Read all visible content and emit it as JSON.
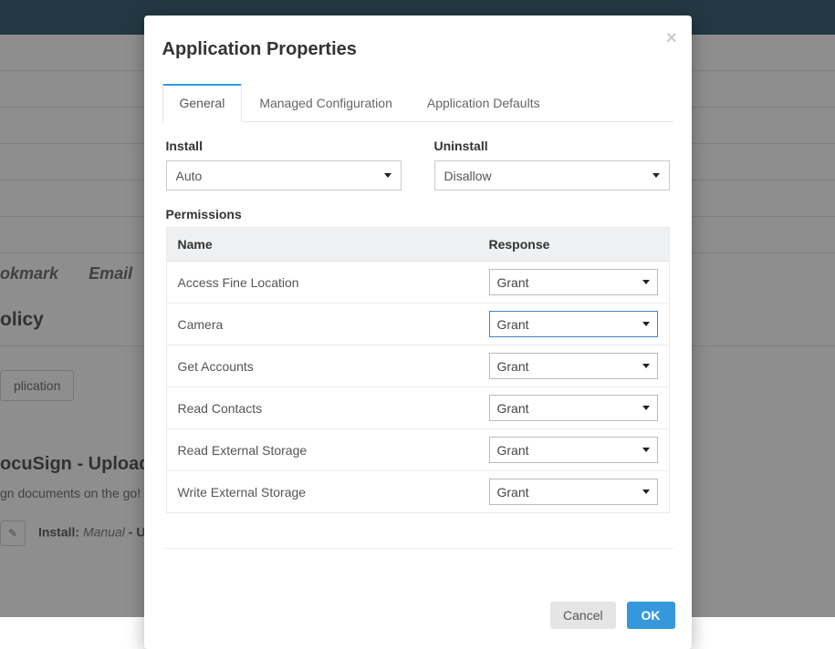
{
  "background": {
    "tab1": "okmark",
    "tab2": "Email",
    "section_heading": "olicy",
    "button_label": "plication",
    "app_title": "ocuSign - Upload & S",
    "app_desc": "gn documents on the go! Se",
    "install_prefix": "Install:",
    "install_mode_word": "Manual",
    "install_suffix": " - Unin"
  },
  "modal": {
    "title": "Application Properties",
    "tabs": [
      {
        "label": "General",
        "active": true
      },
      {
        "label": "Managed Configuration",
        "active": false
      },
      {
        "label": "Application Defaults",
        "active": false
      }
    ],
    "install_label": "Install",
    "install_value": "Auto",
    "uninstall_label": "Uninstall",
    "uninstall_value": "Disallow",
    "permissions_label": "Permissions",
    "col_name": "Name",
    "col_response": "Response",
    "permissions": [
      {
        "name": "Access Fine Location",
        "response": "Grant",
        "highlight": false
      },
      {
        "name": "Camera",
        "response": "Grant",
        "highlight": true
      },
      {
        "name": "Get Accounts",
        "response": "Grant",
        "highlight": false
      },
      {
        "name": "Read Contacts",
        "response": "Grant",
        "highlight": false
      },
      {
        "name": "Read External Storage",
        "response": "Grant",
        "highlight": false
      },
      {
        "name": "Write External Storage",
        "response": "Grant",
        "highlight": false
      }
    ],
    "cancel_label": "Cancel",
    "ok_label": "OK"
  }
}
